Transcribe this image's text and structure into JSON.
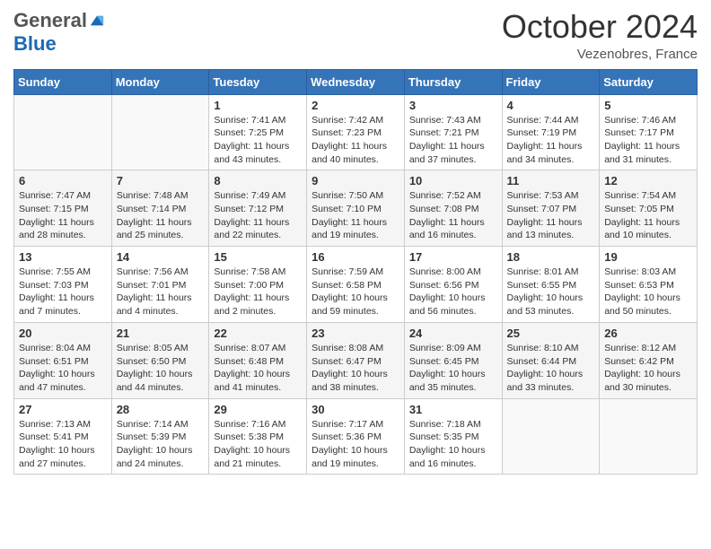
{
  "header": {
    "logo_general": "General",
    "logo_blue": "Blue",
    "month_title": "October 2024",
    "location": "Vezenobres, France"
  },
  "days_of_week": [
    "Sunday",
    "Monday",
    "Tuesday",
    "Wednesday",
    "Thursday",
    "Friday",
    "Saturday"
  ],
  "weeks": [
    [
      {
        "day": "",
        "info": ""
      },
      {
        "day": "",
        "info": ""
      },
      {
        "day": "1",
        "info": "Sunrise: 7:41 AM\nSunset: 7:25 PM\nDaylight: 11 hours and 43 minutes."
      },
      {
        "day": "2",
        "info": "Sunrise: 7:42 AM\nSunset: 7:23 PM\nDaylight: 11 hours and 40 minutes."
      },
      {
        "day": "3",
        "info": "Sunrise: 7:43 AM\nSunset: 7:21 PM\nDaylight: 11 hours and 37 minutes."
      },
      {
        "day": "4",
        "info": "Sunrise: 7:44 AM\nSunset: 7:19 PM\nDaylight: 11 hours and 34 minutes."
      },
      {
        "day": "5",
        "info": "Sunrise: 7:46 AM\nSunset: 7:17 PM\nDaylight: 11 hours and 31 minutes."
      }
    ],
    [
      {
        "day": "6",
        "info": "Sunrise: 7:47 AM\nSunset: 7:15 PM\nDaylight: 11 hours and 28 minutes."
      },
      {
        "day": "7",
        "info": "Sunrise: 7:48 AM\nSunset: 7:14 PM\nDaylight: 11 hours and 25 minutes."
      },
      {
        "day": "8",
        "info": "Sunrise: 7:49 AM\nSunset: 7:12 PM\nDaylight: 11 hours and 22 minutes."
      },
      {
        "day": "9",
        "info": "Sunrise: 7:50 AM\nSunset: 7:10 PM\nDaylight: 11 hours and 19 minutes."
      },
      {
        "day": "10",
        "info": "Sunrise: 7:52 AM\nSunset: 7:08 PM\nDaylight: 11 hours and 16 minutes."
      },
      {
        "day": "11",
        "info": "Sunrise: 7:53 AM\nSunset: 7:07 PM\nDaylight: 11 hours and 13 minutes."
      },
      {
        "day": "12",
        "info": "Sunrise: 7:54 AM\nSunset: 7:05 PM\nDaylight: 11 hours and 10 minutes."
      }
    ],
    [
      {
        "day": "13",
        "info": "Sunrise: 7:55 AM\nSunset: 7:03 PM\nDaylight: 11 hours and 7 minutes."
      },
      {
        "day": "14",
        "info": "Sunrise: 7:56 AM\nSunset: 7:01 PM\nDaylight: 11 hours and 4 minutes."
      },
      {
        "day": "15",
        "info": "Sunrise: 7:58 AM\nSunset: 7:00 PM\nDaylight: 11 hours and 2 minutes."
      },
      {
        "day": "16",
        "info": "Sunrise: 7:59 AM\nSunset: 6:58 PM\nDaylight: 10 hours and 59 minutes."
      },
      {
        "day": "17",
        "info": "Sunrise: 8:00 AM\nSunset: 6:56 PM\nDaylight: 10 hours and 56 minutes."
      },
      {
        "day": "18",
        "info": "Sunrise: 8:01 AM\nSunset: 6:55 PM\nDaylight: 10 hours and 53 minutes."
      },
      {
        "day": "19",
        "info": "Sunrise: 8:03 AM\nSunset: 6:53 PM\nDaylight: 10 hours and 50 minutes."
      }
    ],
    [
      {
        "day": "20",
        "info": "Sunrise: 8:04 AM\nSunset: 6:51 PM\nDaylight: 10 hours and 47 minutes."
      },
      {
        "day": "21",
        "info": "Sunrise: 8:05 AM\nSunset: 6:50 PM\nDaylight: 10 hours and 44 minutes."
      },
      {
        "day": "22",
        "info": "Sunrise: 8:07 AM\nSunset: 6:48 PM\nDaylight: 10 hours and 41 minutes."
      },
      {
        "day": "23",
        "info": "Sunrise: 8:08 AM\nSunset: 6:47 PM\nDaylight: 10 hours and 38 minutes."
      },
      {
        "day": "24",
        "info": "Sunrise: 8:09 AM\nSunset: 6:45 PM\nDaylight: 10 hours and 35 minutes."
      },
      {
        "day": "25",
        "info": "Sunrise: 8:10 AM\nSunset: 6:44 PM\nDaylight: 10 hours and 33 minutes."
      },
      {
        "day": "26",
        "info": "Sunrise: 8:12 AM\nSunset: 6:42 PM\nDaylight: 10 hours and 30 minutes."
      }
    ],
    [
      {
        "day": "27",
        "info": "Sunrise: 7:13 AM\nSunset: 5:41 PM\nDaylight: 10 hours and 27 minutes."
      },
      {
        "day": "28",
        "info": "Sunrise: 7:14 AM\nSunset: 5:39 PM\nDaylight: 10 hours and 24 minutes."
      },
      {
        "day": "29",
        "info": "Sunrise: 7:16 AM\nSunset: 5:38 PM\nDaylight: 10 hours and 21 minutes."
      },
      {
        "day": "30",
        "info": "Sunrise: 7:17 AM\nSunset: 5:36 PM\nDaylight: 10 hours and 19 minutes."
      },
      {
        "day": "31",
        "info": "Sunrise: 7:18 AM\nSunset: 5:35 PM\nDaylight: 10 hours and 16 minutes."
      },
      {
        "day": "",
        "info": ""
      },
      {
        "day": "",
        "info": ""
      }
    ]
  ]
}
